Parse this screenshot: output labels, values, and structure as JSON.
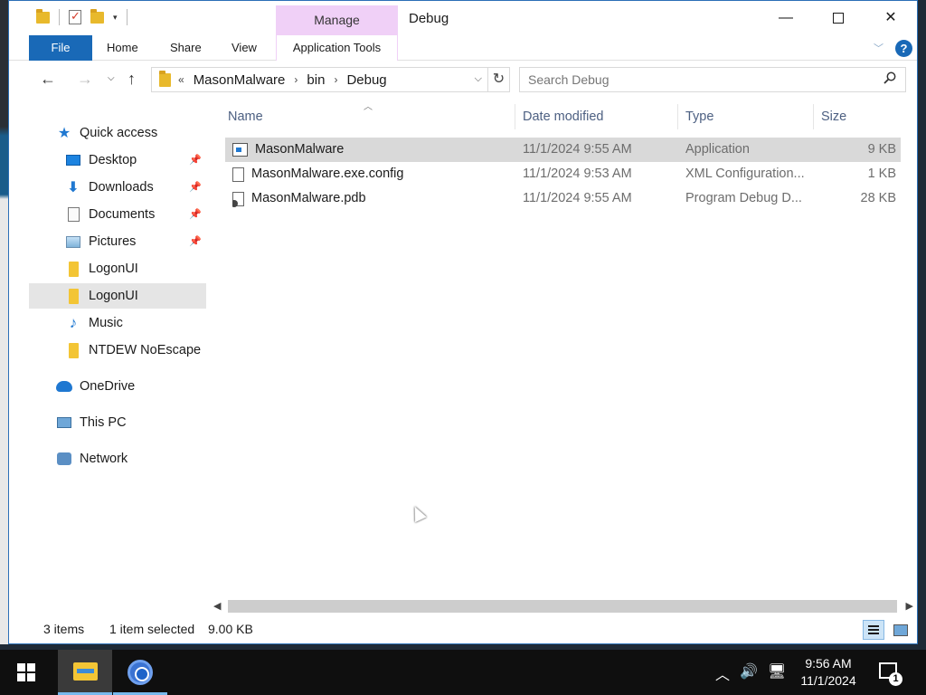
{
  "window": {
    "title": "Debug",
    "context_tab_group": "Manage",
    "controls": {
      "minimize": "—",
      "close": "✕"
    }
  },
  "ribbon": {
    "tabs": [
      "File",
      "Home",
      "Share",
      "View",
      "Application Tools"
    ],
    "help": "?"
  },
  "address": {
    "overflow": "«",
    "breadcrumbs": [
      "MasonMalware",
      "bin",
      "Debug"
    ],
    "search_placeholder": "Search Debug"
  },
  "sidebar": {
    "items": [
      {
        "label": "Quick access",
        "icon": "star-icon",
        "level": 1
      },
      {
        "label": "Desktop",
        "icon": "desktop-icon",
        "level": 2,
        "pinned": true
      },
      {
        "label": "Downloads",
        "icon": "download-icon",
        "level": 2,
        "pinned": true
      },
      {
        "label": "Documents",
        "icon": "document-icon",
        "level": 2,
        "pinned": true
      },
      {
        "label": "Pictures",
        "icon": "pictures-icon",
        "level": 2,
        "pinned": true
      },
      {
        "label": "LogonUI",
        "icon": "folder-icon",
        "level": 2
      },
      {
        "label": "LogonUI",
        "icon": "folder-icon",
        "level": 2,
        "selected": true
      },
      {
        "label": "Music",
        "icon": "music-icon",
        "level": 2
      },
      {
        "label": "NTDEW NoEscape",
        "icon": "folder-icon",
        "level": 2
      },
      {
        "label": "OneDrive",
        "icon": "cloud-icon",
        "level": 1
      },
      {
        "label": "This PC",
        "icon": "computer-icon",
        "level": 1
      },
      {
        "label": "Network",
        "icon": "network-icon",
        "level": 1
      }
    ]
  },
  "filelist": {
    "columns": [
      "Name",
      "Date modified",
      "Type",
      "Size"
    ],
    "rows": [
      {
        "name": "MasonMalware",
        "date": "11/1/2024 9:55 AM",
        "type": "Application",
        "size": "9 KB",
        "icon": "application-icon",
        "selected": true
      },
      {
        "name": "MasonMalware.exe.config",
        "date": "11/1/2024 9:53 AM",
        "type": "XML Configuration...",
        "size": "1 KB",
        "icon": "config-file-icon"
      },
      {
        "name": "MasonMalware.pdb",
        "date": "11/1/2024 9:55 AM",
        "type": "Program Debug D...",
        "size": "28 KB",
        "icon": "debug-file-icon"
      }
    ]
  },
  "status": {
    "item_count": "3 items",
    "selection": "1 item selected",
    "selection_size": "9.00 KB"
  },
  "taskbar": {
    "time": "9:56 AM",
    "date": "11/1/2024",
    "notification_count": "1"
  }
}
